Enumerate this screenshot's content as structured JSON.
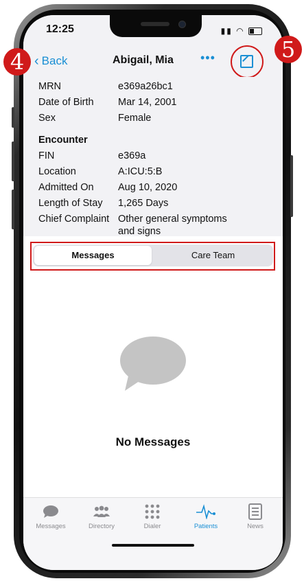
{
  "status": {
    "time": "12:25"
  },
  "nav": {
    "back": "Back",
    "title": "Abigail, Mia",
    "more": "•••"
  },
  "patient": {
    "rows": [
      {
        "label": "MRN",
        "value": "e369a26bc1"
      },
      {
        "label": "Date of Birth",
        "value": "Mar 14, 2001"
      },
      {
        "label": "Sex",
        "value": "Female"
      }
    ],
    "encounter_title": "Encounter",
    "encounter": [
      {
        "label": "FIN",
        "value": "e369a"
      },
      {
        "label": "Location",
        "value": "A:ICU:5:B"
      },
      {
        "label": "Admitted On",
        "value": "Aug 10, 2020"
      },
      {
        "label": "Length of Stay",
        "value": "1,265 Days"
      },
      {
        "label": "Chief Complaint",
        "value": "Other general symptoms",
        "value2": "and signs"
      }
    ]
  },
  "segment": {
    "messages": "Messages",
    "care_team": "Care Team"
  },
  "empty": {
    "text": "No Messages"
  },
  "tabs": [
    {
      "label": "Messages",
      "icon": "chat-bubble-icon"
    },
    {
      "label": "Directory",
      "icon": "people-icon"
    },
    {
      "label": "Dialer",
      "icon": "keypad-icon"
    },
    {
      "label": "Patients",
      "icon": "heartbeat-icon"
    },
    {
      "label": "News",
      "icon": "news-icon"
    }
  ],
  "badges": {
    "back_badge": "4",
    "compose_badge": "5"
  },
  "colors": {
    "accent": "#1a8fd4",
    "highlight": "#d01a1a"
  }
}
